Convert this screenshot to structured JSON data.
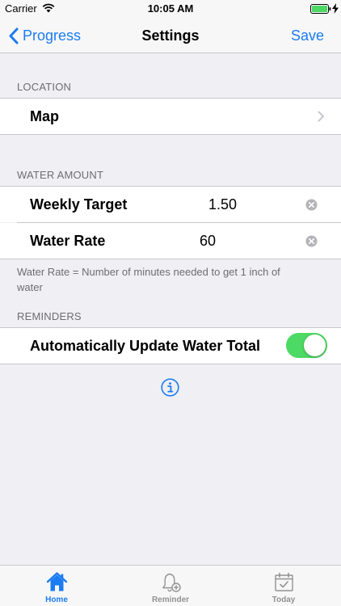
{
  "status_bar": {
    "carrier": "Carrier",
    "time": "10:05 AM"
  },
  "nav": {
    "back_label": "Progress",
    "title": "Settings",
    "save_label": "Save"
  },
  "sections": {
    "location": {
      "header": "LOCATION",
      "map_label": "Map"
    },
    "water_amount": {
      "header": "WATER AMOUNT",
      "weekly_target": {
        "label": "Weekly Target",
        "value": "1.50"
      },
      "water_rate": {
        "label": "Water Rate",
        "value": "60"
      },
      "footer": "Water Rate = Number of minutes needed to get 1 inch of water"
    },
    "reminders": {
      "header": "REMINDERS",
      "auto_update_label": "Automatically Update Water Total",
      "auto_update_on": true
    }
  },
  "tabs": [
    {
      "label": "Home",
      "icon": "home-icon",
      "selected": true
    },
    {
      "label": "Reminder",
      "icon": "bell-icon",
      "selected": false
    },
    {
      "label": "Today",
      "icon": "calendar-icon",
      "selected": false
    }
  ],
  "colors": {
    "accent": "#1b7cf2",
    "toggle_on": "#4cd964",
    "background": "#efeff4",
    "inactive_tab": "#929292"
  }
}
